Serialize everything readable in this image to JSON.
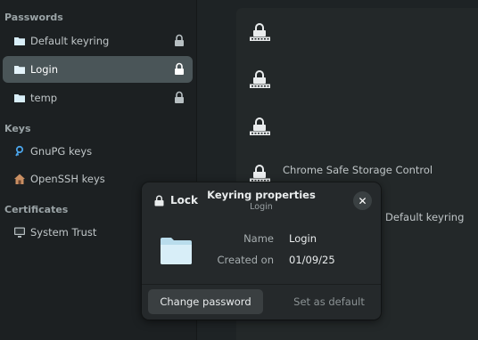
{
  "sidebar": {
    "sections": [
      {
        "title": "Passwords"
      },
      {
        "title": "Keys"
      },
      {
        "title": "Certificates"
      }
    ],
    "passwords": [
      {
        "label": "Default keyring",
        "icon": "folder-icon",
        "locked": true
      },
      {
        "label": "Login",
        "icon": "folder-icon",
        "locked": true,
        "selected": true
      },
      {
        "label": "temp",
        "icon": "folder-icon",
        "locked": true
      }
    ],
    "keys": [
      {
        "label": "GnuPG keys",
        "icon": "key-icon"
      },
      {
        "label": "OpenSSH keys",
        "icon": "home-icon"
      }
    ],
    "certificates": [
      {
        "label": "System Trust",
        "icon": "monitor-icon"
      }
    ]
  },
  "main": {
    "items": [
      {
        "label": "",
        "icon": "locked-password-icon"
      },
      {
        "label": "",
        "icon": "locked-password-icon"
      },
      {
        "label": "",
        "icon": "locked-password-icon"
      },
      {
        "label": "Chrome Safe Storage Control",
        "icon": "locked-password-icon"
      }
    ],
    "partial_text": "r: Default keyring"
  },
  "dialog": {
    "lock_label": "Lock",
    "title": "Keyring properties",
    "subtitle": "Login",
    "close_glyph": "✕",
    "fields": [
      {
        "key": "Name",
        "value": "Login"
      },
      {
        "key": "Created on",
        "value": "01/09/25"
      }
    ],
    "change_password_label": "Change password",
    "set_default_label": "Set as default"
  },
  "colors": {
    "selected_bg": "#4a5558",
    "folder": "#d8eef8",
    "accent_key": "#4aa3e8"
  }
}
